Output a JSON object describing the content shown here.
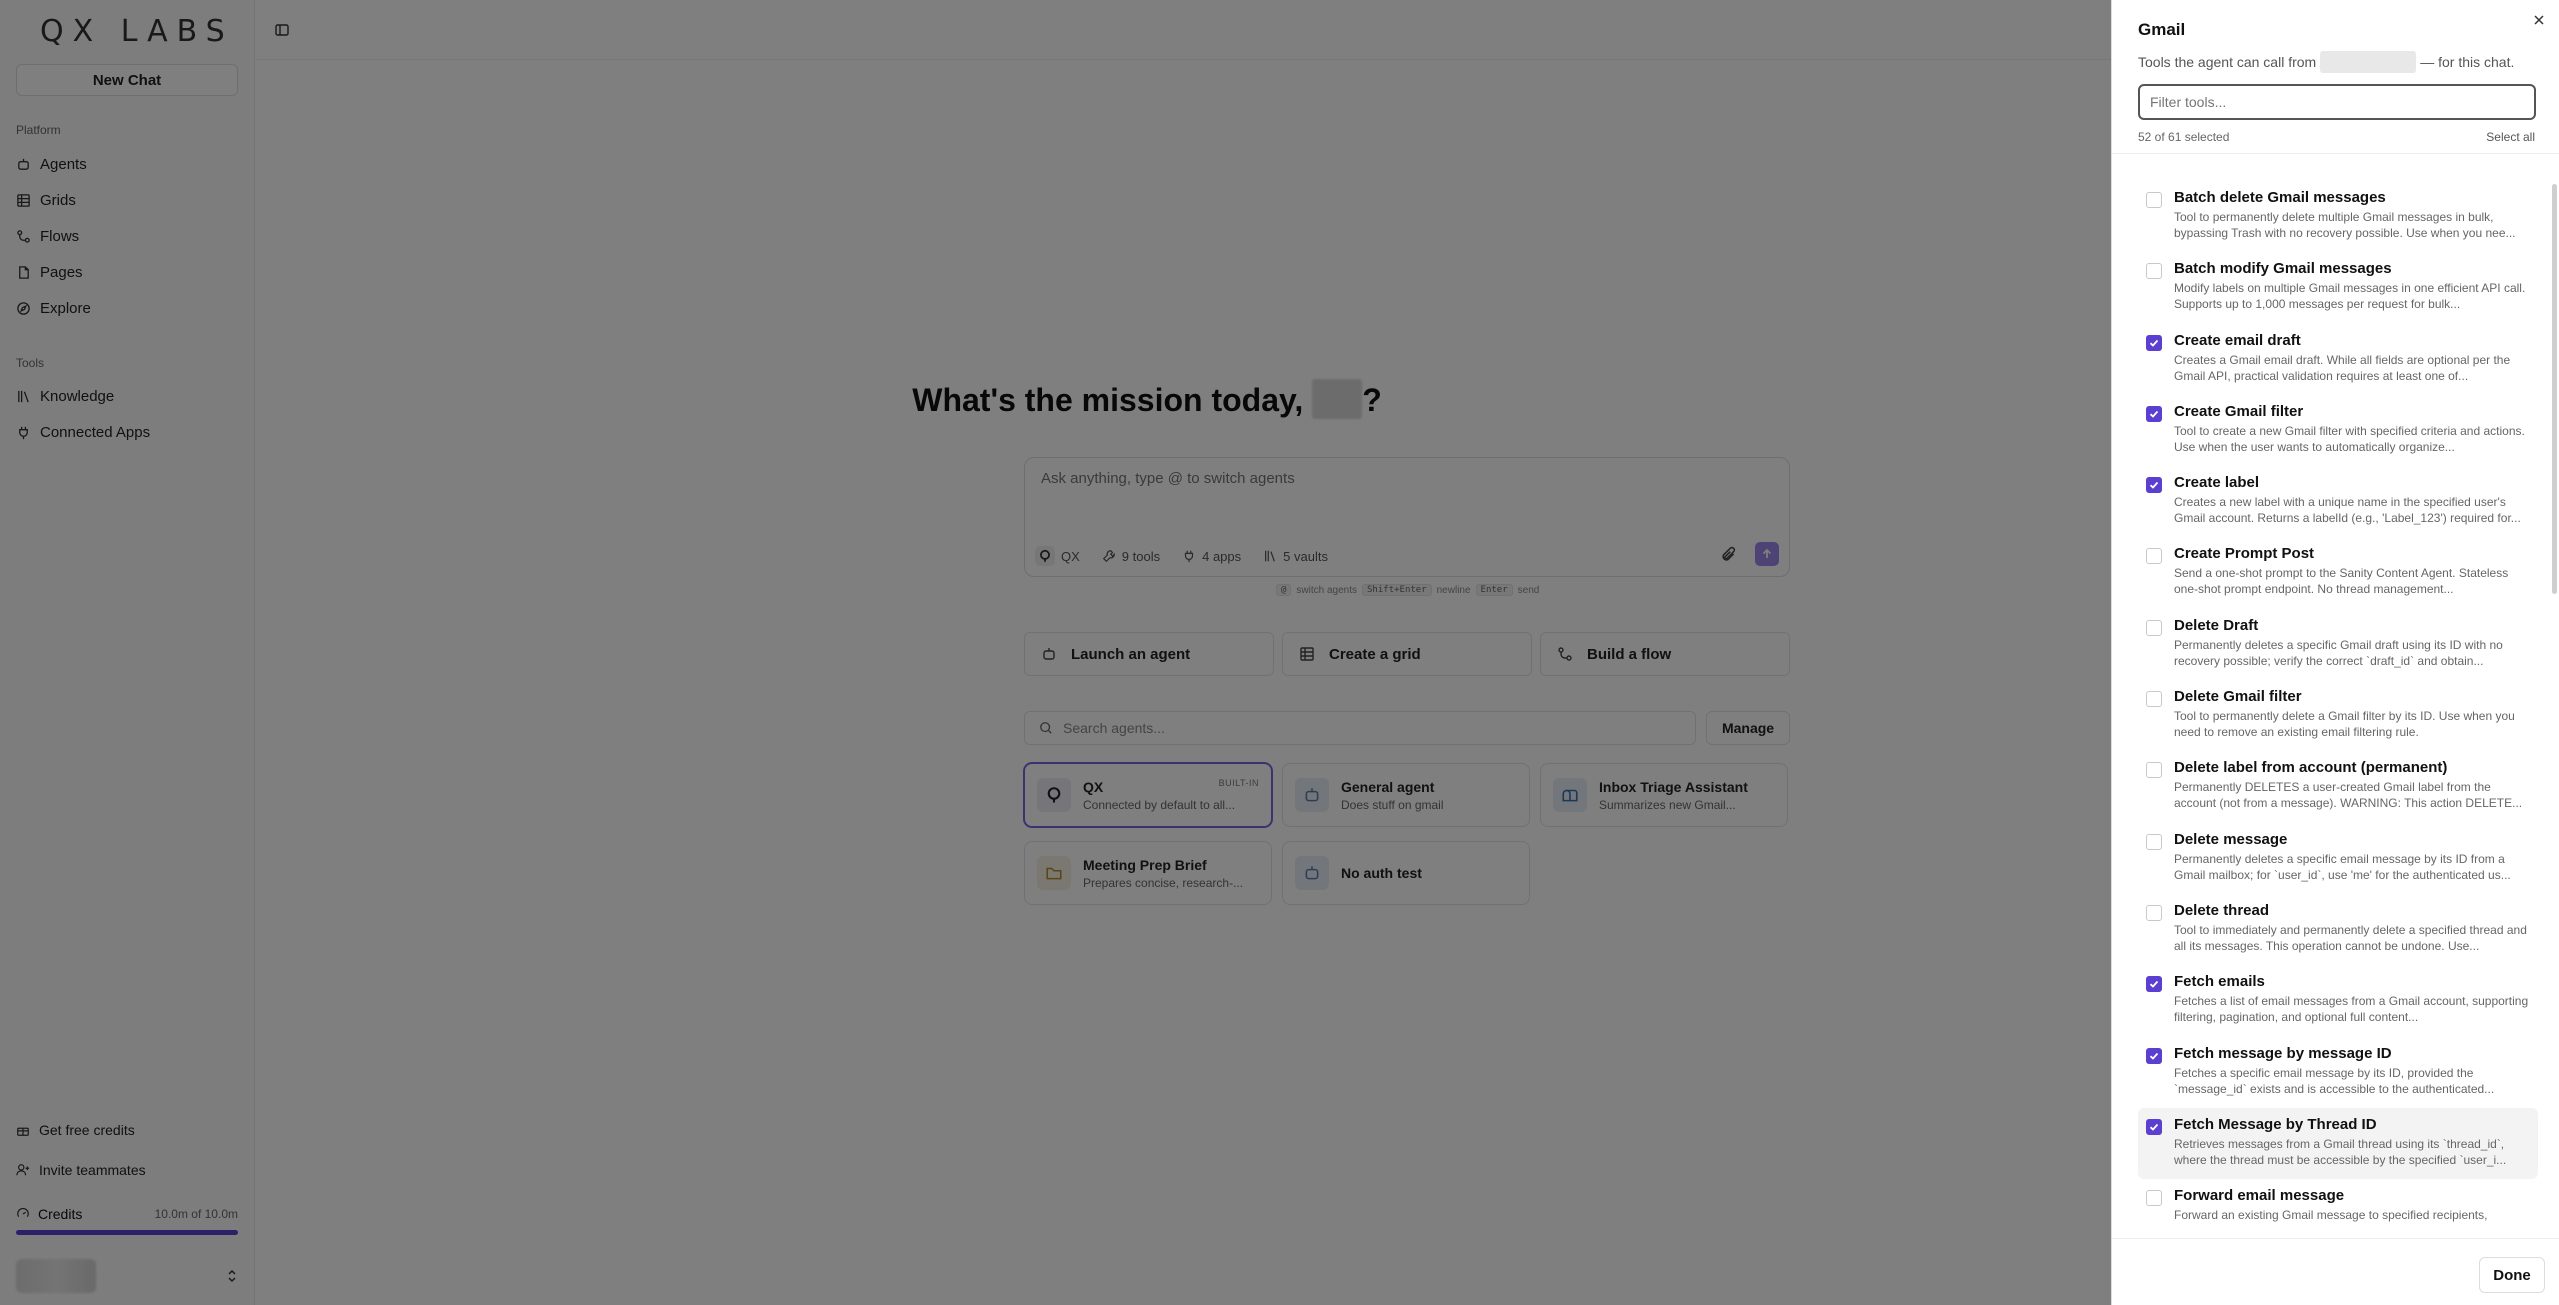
{
  "sidebar": {
    "logo": "QX LABS",
    "new_chat": "New Chat",
    "platform_label": "Platform",
    "platform_items": [
      {
        "label": "Agents",
        "icon": "agents-icon"
      },
      {
        "label": "Grids",
        "icon": "grid-icon"
      },
      {
        "label": "Flows",
        "icon": "flows-icon"
      },
      {
        "label": "Pages",
        "icon": "pages-icon"
      },
      {
        "label": "Explore",
        "icon": "compass-icon"
      }
    ],
    "tools_label": "Tools",
    "tools_items": [
      {
        "label": "Knowledge",
        "icon": "library-icon"
      },
      {
        "label": "Connected Apps",
        "icon": "plug-icon"
      }
    ],
    "get_credits": "Get free credits",
    "invite": "Invite teammates",
    "credits_label": "Credits",
    "credits_amount": "10.0m of 10.0m",
    "credits_fraction": 1.0
  },
  "main": {
    "hero_prefix": "What's the mission today,",
    "hero_suffix": "?",
    "composer_placeholder": "Ask anything, type @ to switch agents",
    "composer_chips": {
      "agent": "QX",
      "tools": "9 tools",
      "apps": "4 apps",
      "vaults": "5 vaults"
    },
    "hints": {
      "key1": "@",
      "text1": "switch agents",
      "key2": "Shift+Enter",
      "text2": "newline",
      "key3": "Enter",
      "text3": "send"
    },
    "quick_actions": [
      {
        "label": "Launch an agent"
      },
      {
        "label": "Create a grid"
      },
      {
        "label": "Build a flow"
      }
    ],
    "search_placeholder": "Search agents...",
    "manage": "Manage",
    "agents": [
      {
        "name": "QX",
        "desc": "Connected by default to all...",
        "badge": "BUILT-IN"
      },
      {
        "name": "General agent",
        "desc": "Does stuff on gmail"
      },
      {
        "name": "Inbox Triage Assistant",
        "desc": "Summarizes new Gmail..."
      },
      {
        "name": "Meeting Prep Brief",
        "desc": "Prepares concise, research-..."
      },
      {
        "name": "No auth test",
        "desc": ""
      }
    ]
  },
  "panel": {
    "title": "Gmail",
    "subtitle_prefix": "Tools the agent can call from",
    "subtitle_suffix": "— for this chat.",
    "filter_placeholder": "Filter tools...",
    "count": "52 of 61 selected",
    "select_all": "Select all",
    "done": "Done",
    "tools": [
      {
        "name": "Batch delete Gmail messages",
        "desc": "Tool to permanently delete multiple Gmail messages in bulk, bypassing Trash with no recovery possible. Use when you nee...",
        "checked": false
      },
      {
        "name": "Batch modify Gmail messages",
        "desc": "Modify labels on multiple Gmail messages in one efficient API call. Supports up to 1,000 messages per request for bulk...",
        "checked": false
      },
      {
        "name": "Create email draft",
        "desc": "Creates a Gmail email draft. While all fields are optional per the Gmail API, practical validation requires at least one of...",
        "checked": true
      },
      {
        "name": "Create Gmail filter",
        "desc": "Tool to create a new Gmail filter with specified criteria and actions. Use when the user wants to automatically organize...",
        "checked": true
      },
      {
        "name": "Create label",
        "desc": "Creates a new label with a unique name in the specified user's Gmail account. Returns a labelId (e.g., 'Label_123') required for...",
        "checked": true
      },
      {
        "name": "Create Prompt Post",
        "desc": "Send a one-shot prompt to the Sanity Content Agent. Stateless one-shot prompt endpoint. No thread management...",
        "checked": false
      },
      {
        "name": "Delete Draft",
        "desc": "Permanently deletes a specific Gmail draft using its ID with no recovery possible; verify the correct `draft_id` and obtain...",
        "checked": false
      },
      {
        "name": "Delete Gmail filter",
        "desc": "Tool to permanently delete a Gmail filter by its ID. Use when you need to remove an existing email filtering rule.",
        "checked": false
      },
      {
        "name": "Delete label from account (permanent)",
        "desc": "Permanently DELETES a user-created Gmail label from the account (not from a message). WARNING: This action DELETE...",
        "checked": false
      },
      {
        "name": "Delete message",
        "desc": "Permanently deletes a specific email message by its ID from a Gmail mailbox; for `user_id`, use 'me' for the authenticated us...",
        "checked": false
      },
      {
        "name": "Delete thread",
        "desc": "Tool to immediately and permanently delete a specified thread and all its messages. This operation cannot be undone. Use...",
        "checked": false
      },
      {
        "name": "Fetch emails",
        "desc": "Fetches a list of email messages from a Gmail account, supporting filtering, pagination, and optional full content...",
        "checked": true
      },
      {
        "name": "Fetch message by message ID",
        "desc": "Fetches a specific email message by its ID, provided the `message_id` exists and is accessible to the authenticated...",
        "checked": true
      },
      {
        "name": "Fetch Message by Thread ID",
        "desc": "Retrieves messages from a Gmail thread using its `thread_id`, where the thread must be accessible by the specified `user_i...",
        "checked": true,
        "hover": true
      },
      {
        "name": "Forward email message",
        "desc": "Forward an existing Gmail message to specified recipients,",
        "checked": false
      }
    ]
  }
}
